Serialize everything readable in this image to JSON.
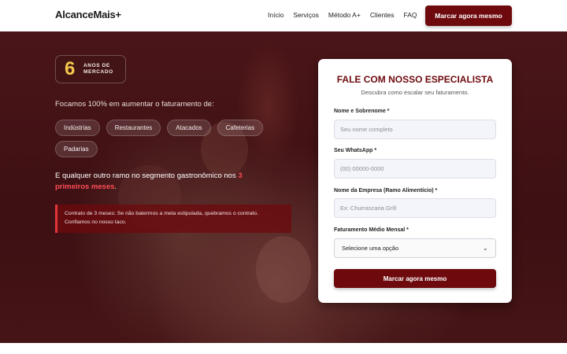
{
  "nav": {
    "brand": "AlcanceMais+",
    "links": [
      "Início",
      "Serviços",
      "Método A+",
      "Clientes",
      "FAQ"
    ],
    "cta": "Marcar agora mesmo"
  },
  "hero": {
    "badge": {
      "number": "6",
      "line1": "ANOS DE",
      "line2": "MERCADO"
    },
    "focus_text": "Focamos 100% em aumentar o faturamento de:",
    "segments": [
      "Indústrias",
      "Restaurantes",
      "Atacados",
      "Cafeterias",
      "Padarias"
    ],
    "claim_prefix": "E qualquer outro ramo no segmento gastronômico nos ",
    "claim_highlight": "3 primeiros meses",
    "claim_suffix": ".",
    "guarantee": "Contrato de 3 meses: Se não batermos a meta estipulada, quebramos o contrato. Confiamos no nosso taco."
  },
  "form": {
    "title": "FALE COM NOSSO ESPECIALISTA",
    "subtitle": "Descubra como escalar seu faturamento.",
    "fields": [
      {
        "label": "Nome e Sobrenome *",
        "placeholder": "Seu nome completo"
      },
      {
        "label": "Seu WhatsApp *",
        "placeholder": "(00) 00000-0000"
      },
      {
        "label": "Nome da Empresa (Ramo Alimentício) *",
        "placeholder": "Ex: Churrascaria Grill"
      }
    ],
    "select": {
      "label": "Faturamento Médio Mensal *",
      "value": "Selecione uma opção"
    },
    "submit": "Marcar agora mesmo"
  },
  "colors": {
    "brand": "#6e0a0e",
    "accent": "#ff4d57",
    "badge_number": "#f2c94c"
  }
}
